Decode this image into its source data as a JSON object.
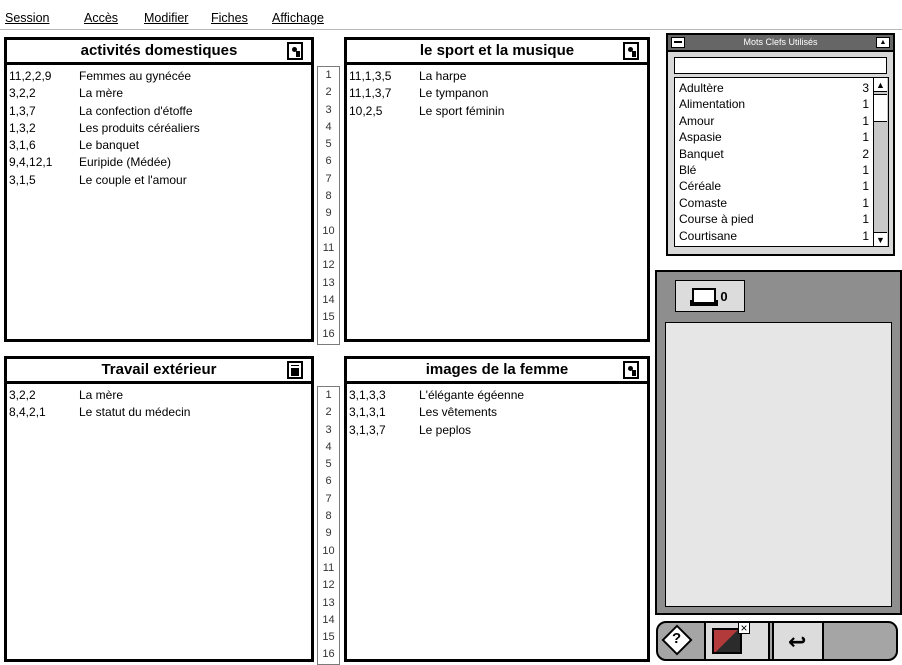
{
  "menu": [
    "Session",
    "Accès",
    "Modifier",
    "Fiches",
    "Affichage"
  ],
  "panels": {
    "top_left": {
      "title": "activités domestiques",
      "rows": [
        {
          "code": "11,2,2,9",
          "text": "Femmes au gynécée"
        },
        {
          "code": "3,2,2",
          "text": "La mère"
        },
        {
          "code": "1,3,7",
          "text": "La confection d'étoffe"
        },
        {
          "code": "1,3,2",
          "text": "Les produits céréaliers"
        },
        {
          "code": "3,1,6",
          "text": "Le banquet"
        },
        {
          "code": "9,4,12,1",
          "text": "Euripide (Médée)"
        },
        {
          "code": "3,1,5",
          "text": "Le couple et l'amour"
        }
      ]
    },
    "top_right": {
      "title": "le sport et la musique",
      "rows": [
        {
          "code": "11,1,3,5",
          "text": "La harpe"
        },
        {
          "code": "11,1,3,7",
          "text": "Le tympanon"
        },
        {
          "code": "10,2,5",
          "text": "Le sport féminin"
        }
      ]
    },
    "bottom_left": {
      "title": "Travail extérieur",
      "rows": [
        {
          "code": "3,2,2",
          "text": "La mère"
        },
        {
          "code": "8,4,2,1",
          "text": "Le statut du médecin"
        }
      ]
    },
    "bottom_right": {
      "title": "images de la femme",
      "rows": [
        {
          "code": "3,1,3,3",
          "text": "L'élégante égéenne"
        },
        {
          "code": "3,1,3,1",
          "text": "Les vêtements"
        },
        {
          "code": "3,1,3,7",
          "text": "Le peplos"
        }
      ]
    }
  },
  "row_numbers": [
    "1",
    "2",
    "3",
    "4",
    "5",
    "6",
    "7",
    "8",
    "9",
    "10",
    "11",
    "12",
    "13",
    "14",
    "15",
    "16"
  ],
  "keywords": {
    "title": "Mots Clefs Utilisés",
    "items": [
      {
        "word": "Adultère",
        "count": "3"
      },
      {
        "word": "Alimentation",
        "count": "1"
      },
      {
        "word": "Amour",
        "count": "1"
      },
      {
        "word": "Aspasie",
        "count": "1"
      },
      {
        "word": "Banquet",
        "count": "2"
      },
      {
        "word": "Blé",
        "count": "1"
      },
      {
        "word": "Céréale",
        "count": "1"
      },
      {
        "word": "Comaste",
        "count": "1"
      },
      {
        "word": "Course à pied",
        "count": "1"
      },
      {
        "word": "Courtisane",
        "count": "1"
      }
    ]
  },
  "tray": {
    "count": "0"
  },
  "icons": {
    "panel_header": "vase-icon",
    "doc_header": "document-icon",
    "tray": "inbox-tray-icon",
    "help": "help-icon",
    "color": "color-swatch-icon",
    "return": "return-arrow-icon"
  },
  "toolbar": {
    "help_label": "?",
    "return_label": "↩"
  }
}
